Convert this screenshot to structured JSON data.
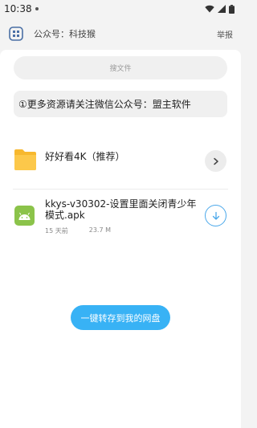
{
  "status_bar": {
    "time": "10:38",
    "icons": [
      "wifi-icon",
      "signal-icon",
      "battery-icon"
    ]
  },
  "header": {
    "title": "公众号：科技猴",
    "report": "举报"
  },
  "search": {
    "placeholder": "搜文件"
  },
  "notice": {
    "text": "①更多资源请关注微信公众号：盟主软件"
  },
  "folder": {
    "name": "好好看4K（推荐）"
  },
  "file": {
    "name": "kkys-v30302-设置里面关闭青少年模式.apk",
    "age": "15 天前",
    "size": "23.7 M"
  },
  "actions": {
    "save_label": "一键转存到我的网盘"
  },
  "colors": {
    "accent": "#38b2f5",
    "folder": "#f7b82e",
    "apk": "#8bc34a",
    "download": "#4aa8ea"
  }
}
